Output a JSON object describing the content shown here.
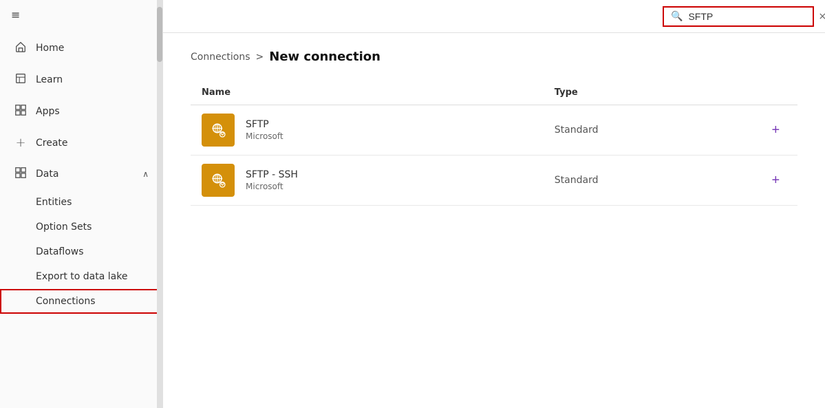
{
  "sidebar": {
    "hamburger": "≡",
    "items": [
      {
        "id": "home",
        "label": "Home",
        "icon": "⌂"
      },
      {
        "id": "learn",
        "label": "Learn",
        "icon": "📖"
      },
      {
        "id": "apps",
        "label": "Apps",
        "icon": "⊞"
      },
      {
        "id": "create",
        "label": "Create",
        "icon": "+"
      }
    ],
    "data_section": {
      "label": "Data",
      "icon": "⊟",
      "chevron": "∧",
      "sub_items": [
        {
          "id": "entities",
          "label": "Entities"
        },
        {
          "id": "option-sets",
          "label": "Option Sets"
        },
        {
          "id": "dataflows",
          "label": "Dataflows"
        },
        {
          "id": "export-to-data-lake",
          "label": "Export to data lake"
        },
        {
          "id": "connections",
          "label": "Connections",
          "active": true
        }
      ]
    }
  },
  "topbar": {
    "search_placeholder": "SFTP",
    "search_value": "SFTP",
    "clear_label": "×"
  },
  "content": {
    "breadcrumb_parent": "Connections",
    "breadcrumb_separator": ">",
    "breadcrumb_current": "New connection",
    "table": {
      "col_name": "Name",
      "col_type": "Type",
      "rows": [
        {
          "id": "sftp",
          "name": "SFTP",
          "publisher": "Microsoft",
          "type": "Standard",
          "icon_color": "#d4900a"
        },
        {
          "id": "sftp-ssh",
          "name": "SFTP - SSH",
          "publisher": "Microsoft",
          "type": "Standard",
          "icon_color": "#d4900a"
        }
      ],
      "add_button_label": "+"
    }
  }
}
